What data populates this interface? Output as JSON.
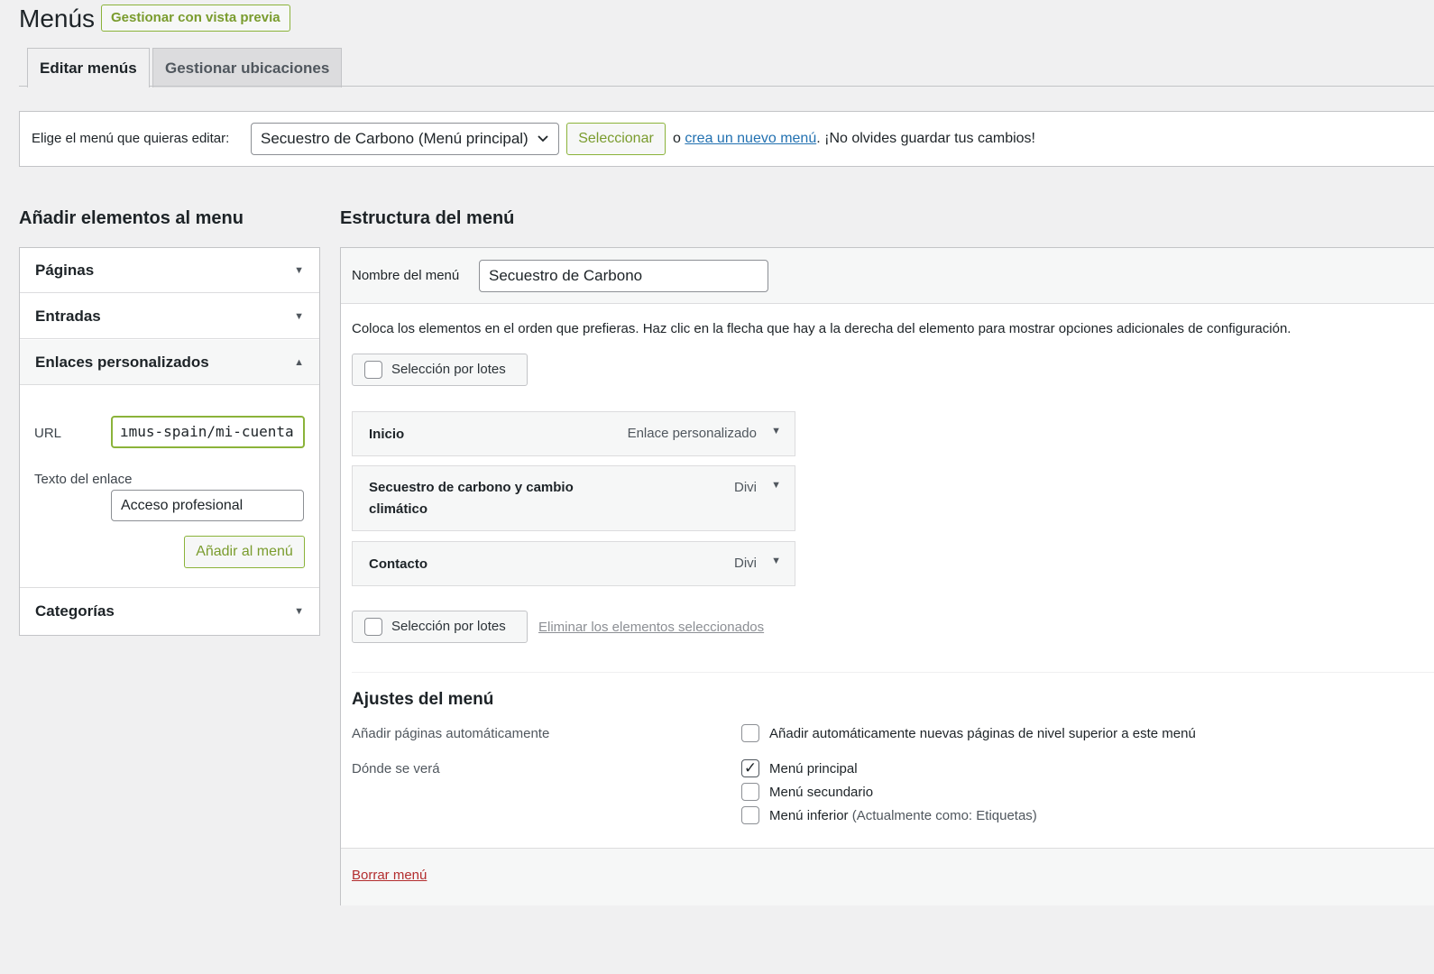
{
  "header": {
    "title": "Menús",
    "preview_button": "Gestionar con vista previa"
  },
  "tabs": [
    {
      "label": "Editar menús",
      "active": true
    },
    {
      "label": "Gestionar ubicaciones",
      "active": false
    }
  ],
  "menu_selector": {
    "label": "Elige el menú que quieras editar:",
    "selected": "Secuestro de Carbono (Menú principal)",
    "select_button": "Seleccionar",
    "note_prefix": "o ",
    "note_link": "crea un nuevo menú",
    "note_suffix": ". ¡No olvides guardar tus cambios!"
  },
  "add_items": {
    "title": "Añadir elementos al menu",
    "sections": [
      {
        "label": "Páginas",
        "expanded": false
      },
      {
        "label": "Entradas",
        "expanded": false
      },
      {
        "label": "Enlaces personalizados",
        "expanded": true
      },
      {
        "label": "Categorías",
        "expanded": false
      }
    ],
    "custom_links": {
      "url_label": "URL",
      "url_value": "ımus-spain/mi-cuenta",
      "link_text_label": "Texto del enlace",
      "link_text_value": "Acceso profesional",
      "add_button": "Añadir al menú"
    }
  },
  "structure": {
    "title": "Estructura del menú",
    "name_label": "Nombre del menú",
    "name_value": "Secuestro de Carbono",
    "instructions": "Coloca los elementos en el orden que prefieras. Haz clic en la flecha que hay a la derecha del elemento para mostrar opciones adicionales de configuración.",
    "bulk_select_label": "Selección por lotes",
    "delete_selected": "Eliminar los elementos seleccionados",
    "items": [
      {
        "title_line1": "Inicio",
        "title_line2": "",
        "type": "Enlace personalizado"
      },
      {
        "title_line1": "Secuestro de carbono y cambio",
        "title_line2": "climático",
        "type": "Divi"
      },
      {
        "title_line1": "Contacto",
        "title_line2": "",
        "type": "Divi"
      }
    ],
    "settings": {
      "title": "Ajustes del menú",
      "auto_add_label": "Añadir páginas automáticamente",
      "auto_add_option": "Añadir automáticamente nuevas páginas de nivel superior a este menú",
      "location_label": "Dónde se verá",
      "locations": [
        {
          "label": "Menú principal",
          "note": "",
          "checked": true
        },
        {
          "label": "Menú secundario",
          "note": "",
          "checked": false
        },
        {
          "label": "Menú inferior",
          "note": " (Actualmente como: Etiquetas)",
          "checked": false
        }
      ]
    },
    "delete_menu": "Borrar menú"
  },
  "colors": {
    "accent_green": "#8bb33a",
    "link_blue": "#2271b1",
    "danger_red": "#b32d2e"
  }
}
